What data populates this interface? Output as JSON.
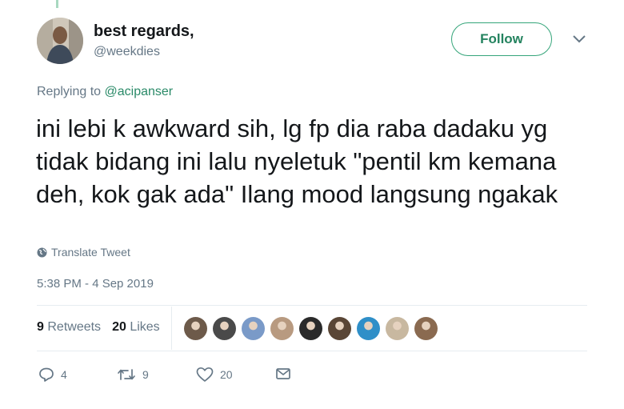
{
  "user": {
    "display_name": "best regards,",
    "handle": "@weekdies",
    "follow_label": "Follow"
  },
  "reply": {
    "prefix": "Replying to ",
    "mention": "@acipanser"
  },
  "tweet": {
    "text": "ini lebi k awkward sih, lg fp dia raba dadaku yg tidak bidang ini lalu nyeletuk \"pentil km kemana deh, kok gak ada\" Ilang mood langsung ngakak",
    "translate_label": "Translate Tweet",
    "timestamp": "5:38 PM - 4 Sep 2019"
  },
  "stats": {
    "retweets_count": "9",
    "retweets_label": "Retweets",
    "likes_count": "20",
    "likes_label": "Likes",
    "liker_colors": [
      "#6d5a4a",
      "#4a4a4a",
      "#7a9ac8",
      "#b89a80",
      "#2a2a2a",
      "#5a4636",
      "#2f8fc8",
      "#c8b8a0",
      "#8a6a50"
    ]
  },
  "actions": {
    "replies": "4",
    "retweets": "9",
    "likes": "20"
  },
  "colors": {
    "accent": "#35a57a",
    "muted": "#657786",
    "text": "#14171a"
  }
}
